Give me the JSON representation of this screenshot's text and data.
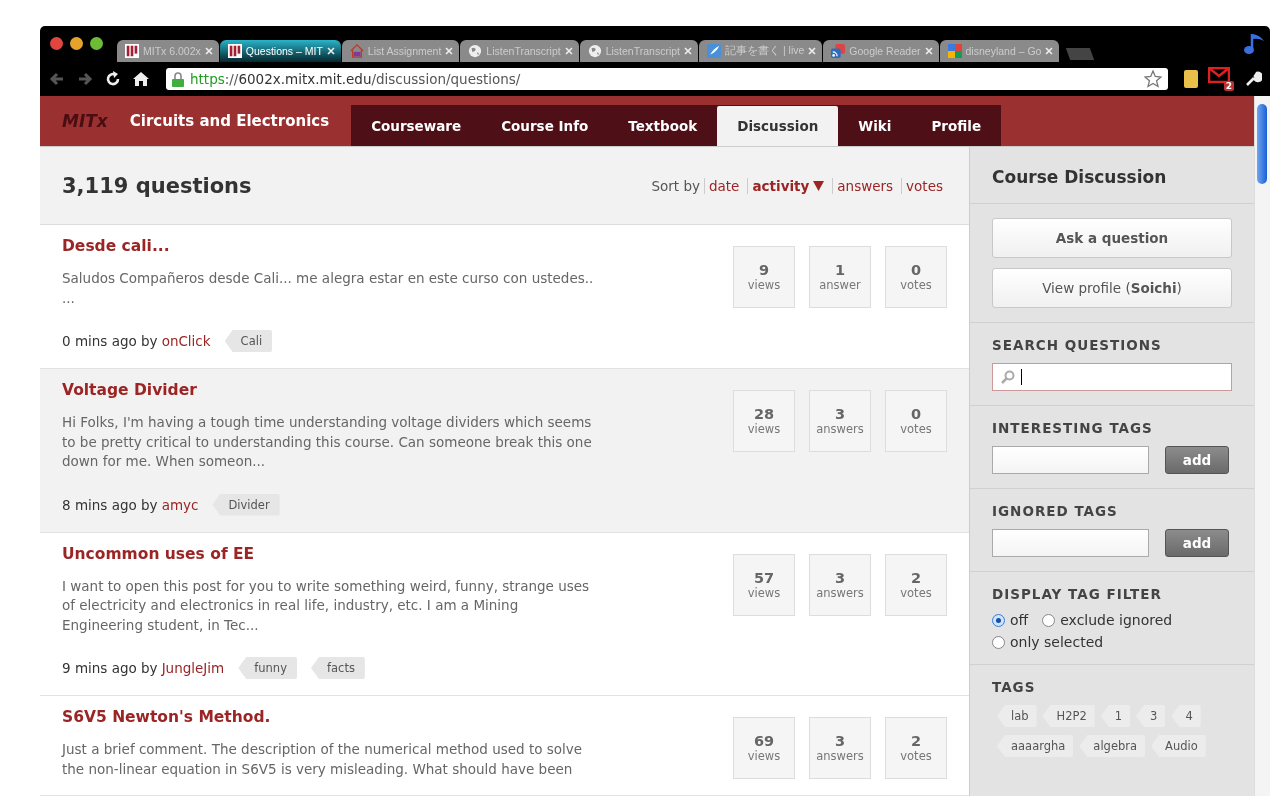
{
  "browser": {
    "tabs": [
      {
        "label": "MITx 6.002x",
        "selected": false
      },
      {
        "label": "Questions – MIT",
        "selected": true
      },
      {
        "label": "List Assignment",
        "selected": false
      },
      {
        "label": "ListenTranscript",
        "selected": false
      },
      {
        "label": "ListenTranscript",
        "selected": false
      },
      {
        "label": "記事を書く | live",
        "selected": false
      },
      {
        "label": "Google Reader",
        "selected": false
      },
      {
        "label": "disneyland – Go",
        "selected": false
      }
    ],
    "url": {
      "scheme": "https",
      "separator": "://",
      "host": "6002x.mitx.mit.edu",
      "path": "/discussion/questions/"
    },
    "mail_badge": "2"
  },
  "site": {
    "logo": "MITx",
    "course": "Circuits and Electronics",
    "nav": [
      {
        "label": "Courseware",
        "selected": false
      },
      {
        "label": "Course Info",
        "selected": false
      },
      {
        "label": "Textbook",
        "selected": false
      },
      {
        "label": "Discussion",
        "selected": true
      },
      {
        "label": "Wiki",
        "selected": false
      },
      {
        "label": "Profile",
        "selected": false
      }
    ]
  },
  "questions_header": {
    "count": "3,119 questions",
    "sort_label": "Sort by",
    "sort_options": [
      {
        "label": "date",
        "selected": false
      },
      {
        "label": "activity",
        "selected": true
      },
      {
        "label": "answers",
        "selected": false
      },
      {
        "label": "votes",
        "selected": false
      }
    ]
  },
  "questions": [
    {
      "title": "Desde cali...",
      "excerpt": "Saludos Compañeros desde Cali... me alegra estar en este curso con ustedes..\n...",
      "age": "0 mins ago by",
      "author": "onClick",
      "tags": [
        "Cali"
      ],
      "highlighted": false,
      "stats": [
        {
          "value": "9",
          "label": "views"
        },
        {
          "value": "1",
          "label": "answer"
        },
        {
          "value": "0",
          "label": "votes"
        }
      ]
    },
    {
      "title": "Voltage Divider",
      "excerpt": "Hi Folks, I'm having a tough time understanding voltage dividers which seems\nto be pretty critical to understanding this course. Can someone break this one\ndown for me. When someon...",
      "age": "8 mins ago by",
      "author": "amyc",
      "tags": [
        "Divider"
      ],
      "highlighted": true,
      "stats": [
        {
          "value": "28",
          "label": "views"
        },
        {
          "value": "3",
          "label": "answers"
        },
        {
          "value": "0",
          "label": "votes"
        }
      ]
    },
    {
      "title": "Uncommon uses of EE",
      "excerpt": "I want to open this post for you to write something weird, funny, strange uses\nof electricity and electronics in real life, industry, etc. I am a Mining\nEngineering student, in Tec...",
      "age": "9 mins ago by",
      "author": "JungleJim",
      "tags": [
        "funny",
        "facts"
      ],
      "highlighted": false,
      "stats": [
        {
          "value": "57",
          "label": "views"
        },
        {
          "value": "3",
          "label": "answers"
        },
        {
          "value": "2",
          "label": "votes"
        }
      ]
    },
    {
      "title": "S6V5 Newton's Method.",
      "excerpt": "Just a brief comment. The description of the numerical method used to solve\nthe non-linear equation in S6V5 is very misleading. What should have been",
      "highlighted": false,
      "stats": [
        {
          "value": "69",
          "label": "views"
        },
        {
          "value": "3",
          "label": "answers"
        },
        {
          "value": "2",
          "label": "votes"
        }
      ]
    }
  ],
  "sidebar": {
    "title": "Course Discussion",
    "ask_button": "Ask a question",
    "profile_button": "View profile (**Soichi**)",
    "search": {
      "heading": "SEARCH QUESTIONS"
    },
    "interesting_tags": {
      "heading": "INTERESTING TAGS",
      "button": "add"
    },
    "ignored_tags": {
      "heading": "IGNORED TAGS",
      "button": "add"
    },
    "tag_filter": {
      "heading": "DISPLAY TAG FILTER",
      "options": [
        {
          "label": "off",
          "selected": true
        },
        {
          "label": "exclude ignored",
          "selected": false
        },
        {
          "label": "only selected",
          "selected": false
        }
      ]
    },
    "tags": {
      "heading": "TAGS",
      "items": [
        "lab",
        "H2P2",
        "1",
        "3",
        "4",
        "aaaargha",
        "algebra",
        "Audio"
      ]
    }
  }
}
